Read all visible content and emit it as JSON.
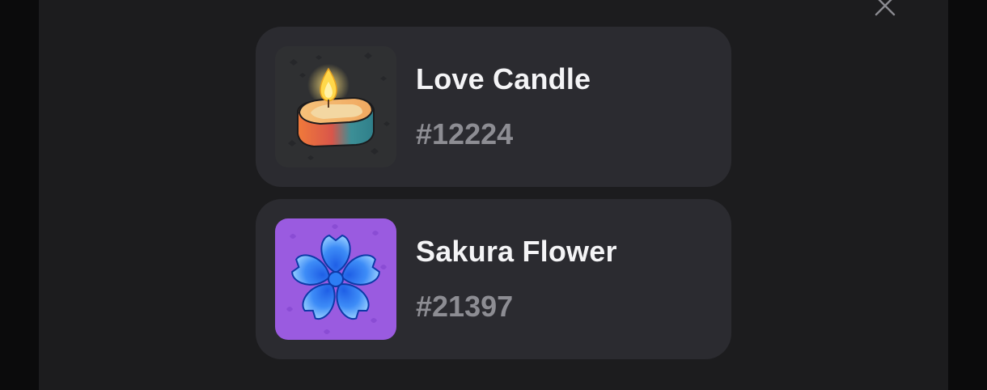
{
  "modal": {
    "close_icon": "close-icon"
  },
  "items": [
    {
      "name": "Love Candle",
      "number": "#12224",
      "icon": "candle-icon",
      "thumb_bg": "#2f3032"
    },
    {
      "name": "Sakura Flower",
      "number": "#21397",
      "icon": "flower-icon",
      "thumb_bg": "#9a5be0"
    }
  ],
  "colors": {
    "page_bg": "#0b0b0c",
    "modal_bg": "#1c1c1e",
    "card_bg": "#2b2b30",
    "name_text": "#f4f4f6",
    "number_text": "#8d8d93"
  }
}
